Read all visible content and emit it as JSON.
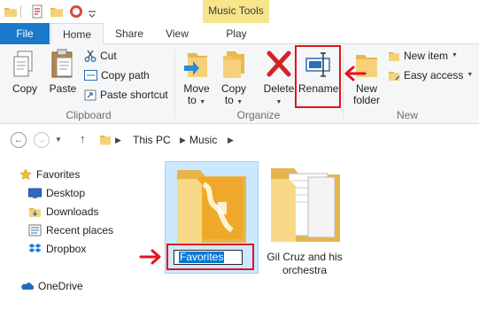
{
  "titlebar": {
    "context_tab_group": "Music Tools",
    "quick_access": [
      "folder-icon",
      "properties-icon",
      "new-folder-icon",
      "undo-icon",
      "customize-quick-access-icon"
    ]
  },
  "tabs": {
    "file": "File",
    "home": "Home",
    "share": "Share",
    "view": "View",
    "play": "Play"
  },
  "ribbon": {
    "clipboard": {
      "copy": "Copy",
      "paste": "Paste",
      "cut": "Cut",
      "copy_path": "Copy path",
      "paste_shortcut": "Paste shortcut",
      "label": "Clipboard"
    },
    "organize": {
      "move_to_line1": "Move",
      "move_to_line2": "to",
      "copy_to_line1": "Copy",
      "copy_to_line2": "to",
      "delete": "Delete",
      "rename": "Rename",
      "label": "Organize"
    },
    "new": {
      "new_folder_line1": "New",
      "new_folder_line2": "folder",
      "new_item": "New item",
      "easy_access": "Easy access",
      "label": "New"
    }
  },
  "address": {
    "breadcrumbs": [
      "This PC",
      "Music"
    ]
  },
  "nav": {
    "favorites": "Favorites",
    "desktop": "Desktop",
    "downloads": "Downloads",
    "recent_places": "Recent places",
    "dropbox": "Dropbox",
    "onedrive": "OneDrive"
  },
  "content": {
    "rename_value": "Favorites",
    "folder2_line1": "Gil Cruz and his",
    "folder2_line2": "orchestra"
  },
  "colors": {
    "file_tab": "#1979ca",
    "context_tab": "#f6e58a",
    "selection": "#cce8ff",
    "highlight": "#e0141e"
  }
}
